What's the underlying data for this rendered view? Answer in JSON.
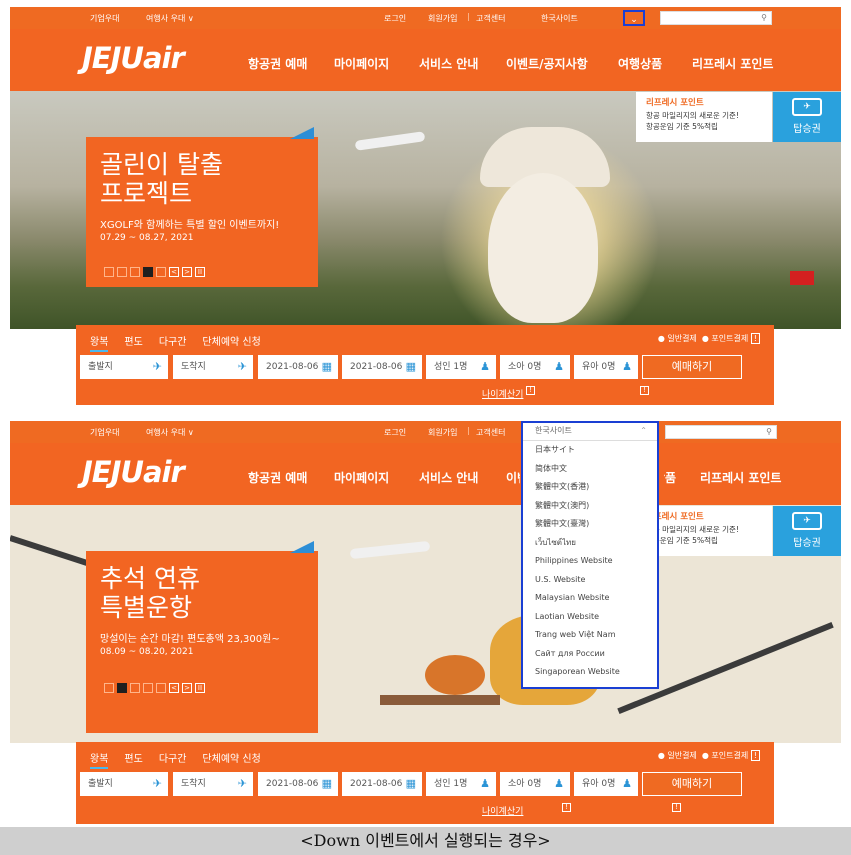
{
  "top": {
    "corporate": "기업우대",
    "travel_agency": "여행사 우대 ∨",
    "login": "로그인",
    "signup": "회원가입",
    "divider": "|",
    "customer_center": "고객센터",
    "site_select": "한국사이트",
    "search_placeholder": ""
  },
  "nav": {
    "logo": "JEJUair",
    "menu": [
      "항공권 예매",
      "마이페이지",
      "서비스 안내",
      "이벤트/공지사항",
      "여행상품",
      "리프레시 포인트"
    ]
  },
  "refresh_banner": {
    "title": "리프레시 포인트",
    "line1": "항공 마일리지의 새로운 기준!",
    "line2": "항공운임 기준 5%적립",
    "board_label": "탑승권"
  },
  "screen1_promo": {
    "title1": "골린이 탈출",
    "title2": "프로젝트",
    "subtitle": "XGOLF와 함께하는 특별 할인 이벤트까지!",
    "dates": "07.29 ~ 08.27, 2021",
    "pager": [
      "",
      "",
      "",
      "",
      "",
      "<",
      ">",
      "II"
    ]
  },
  "screen2_promo": {
    "title1": "추석 연휴",
    "title2": "특별운항",
    "subtitle": "망설이는 순간 마감! 편도총액 23,300원~",
    "dates": "08.09 ~ 08.20, 2021",
    "pager": [
      "",
      "",
      "",
      "",
      "",
      "<",
      ">",
      "II"
    ]
  },
  "booking": {
    "tabs": [
      "왕복",
      "편도",
      "다구간",
      "단체예약 신청"
    ],
    "pay_normal": "일반결제",
    "pay_point": "포인트결제",
    "departure": "출발지",
    "arrival": "도착지",
    "date_out": "2021-08-06",
    "date_in": "2021-08-06",
    "adult": "성인 1명",
    "child": "소아 0명",
    "infant": "유아 0명",
    "book_button": "예매하기",
    "age_calc": "나이계산기",
    "info": "!"
  },
  "dropdown": {
    "current": "한국사이트",
    "options": [
      "日本サイト",
      "简体中文",
      "繁體中文(香港)",
      "繁體中文(澳門)",
      "繁體中文(臺灣)",
      "เว็บไซต์ไทย",
      "Philippines Website",
      "U.S. Website",
      "Malaysian Website",
      "Laotian Website",
      "Trang web Việt Nam",
      "Сайт для России",
      "Singaporean Website"
    ]
  },
  "caption": "<Down 이벤트에서 실행되는 경우>",
  "colors": {
    "brand": "#f26522",
    "highlight": "#1a3fd3",
    "accent_blue": "#2aa1dd"
  }
}
